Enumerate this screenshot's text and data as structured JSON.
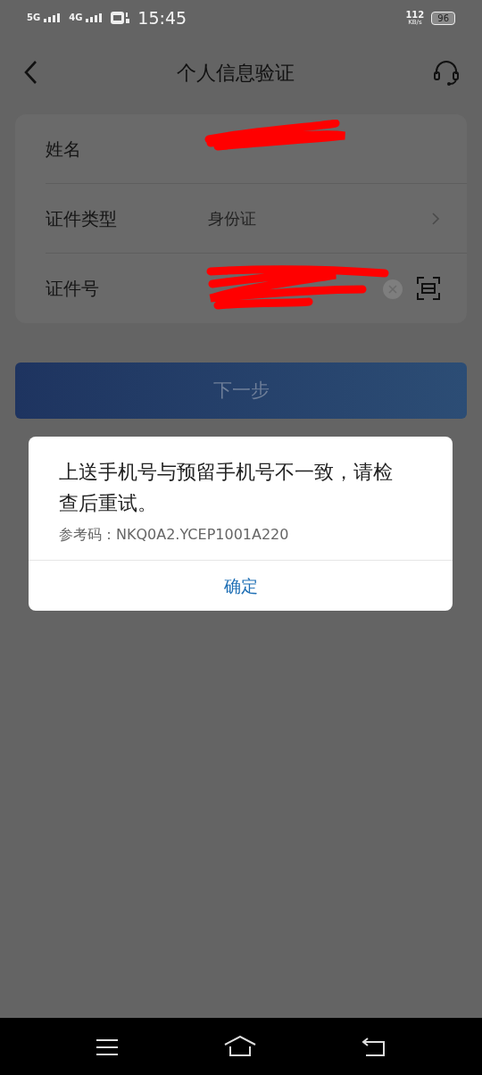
{
  "status_bar": {
    "networks": [
      "5G",
      "4G"
    ],
    "time": "15:45",
    "speed": "112",
    "speed_unit": "KB/s",
    "battery": "96"
  },
  "header": {
    "title": "个人信息验证"
  },
  "form": {
    "rows": [
      {
        "kind": "text",
        "label": "姓名",
        "redacted": true
      },
      {
        "kind": "select",
        "label": "证件类型",
        "value": "身份证"
      },
      {
        "kind": "id",
        "label": "证件号",
        "redacted": true
      }
    ]
  },
  "next_button": {
    "label": "下一步",
    "disabled": true
  },
  "dialog": {
    "message": "上送手机号与预留手机号不一致，请检查后重试。",
    "ref_code": "参考码：NKQ0A2.YCEP1001A220",
    "confirm": "确定"
  }
}
